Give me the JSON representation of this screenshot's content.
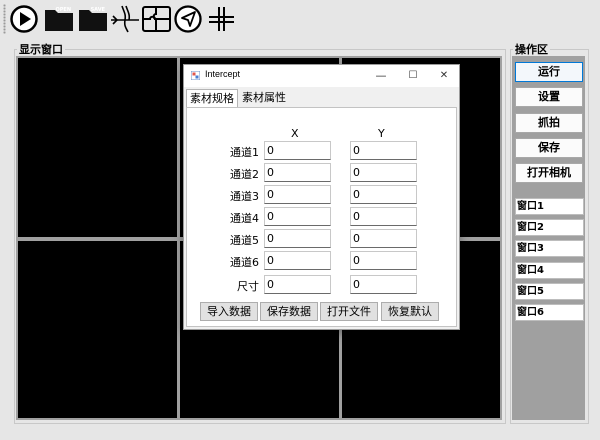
{
  "toolbar": {
    "items": [
      {
        "name": "play-icon"
      },
      {
        "name": "open-folder-icon",
        "tag": "OPEN"
      },
      {
        "name": "save-folder-icon",
        "tag": "SAVE"
      },
      {
        "name": "lane-split-icon"
      },
      {
        "name": "puzzle-icon"
      },
      {
        "name": "navigation-arrow-icon"
      },
      {
        "name": "crosshair-grid-icon"
      }
    ]
  },
  "display": {
    "title": "显示窗口"
  },
  "operations": {
    "title": "操作区",
    "buttons": [
      "运行",
      "设置",
      "抓拍",
      "保存",
      "打开相机"
    ],
    "windows": [
      "窗口1",
      "窗口2",
      "窗口3",
      "窗口4",
      "窗口5",
      "窗口6"
    ]
  },
  "dialog": {
    "title": "Intercept",
    "controls": {
      "minimize": "—",
      "maximize": "☐",
      "close": "✕"
    },
    "tabs": [
      "素材规格",
      "素材属性"
    ],
    "col_x": "X",
    "col_y": "Y",
    "rows": [
      {
        "label": "通道1",
        "x": "0",
        "y": "0"
      },
      {
        "label": "通道2",
        "x": "0",
        "y": "0"
      },
      {
        "label": "通道3",
        "x": "0",
        "y": "0"
      },
      {
        "label": "通道4",
        "x": "0",
        "y": "0"
      },
      {
        "label": "通道5",
        "x": "0",
        "y": "0"
      },
      {
        "label": "通道6",
        "x": "0",
        "y": "0"
      },
      {
        "label": "尺寸",
        "x": "0",
        "y": "0"
      }
    ],
    "buttons": [
      "导入数据",
      "保存数据",
      "打开文件",
      "恢复默认"
    ]
  },
  "colors": {
    "accent": "#0078d7",
    "video_bg": "#000000",
    "panel_bg": "#a0a0a0"
  }
}
